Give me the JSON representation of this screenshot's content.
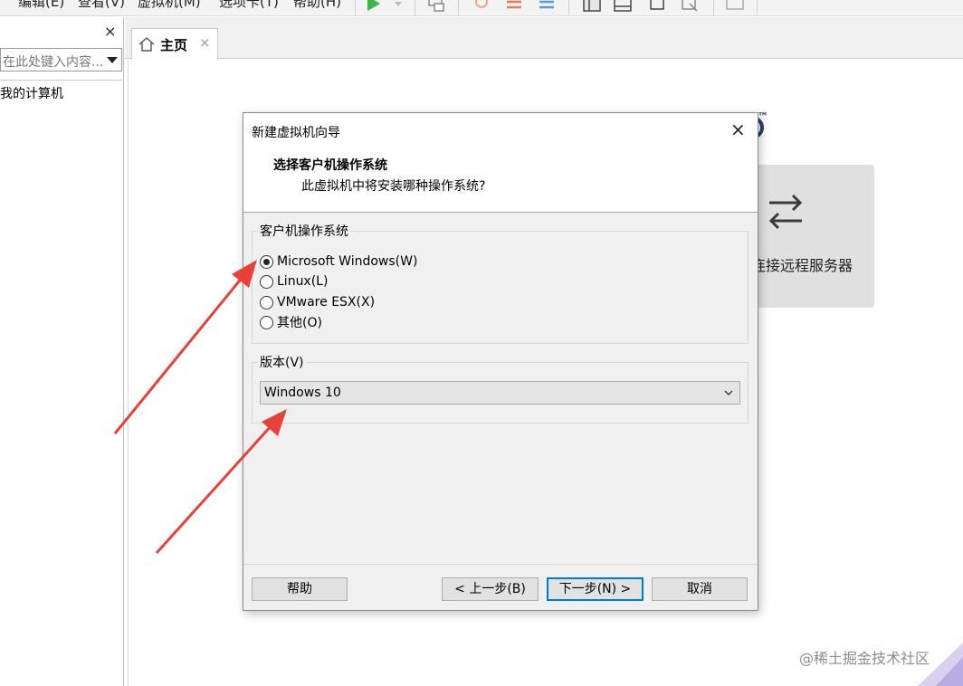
{
  "menu": {
    "items": [
      "编辑(E)",
      "查看(V)",
      "虚拟机(M)",
      "选项卡(T)",
      "帮助(H)"
    ]
  },
  "library": {
    "close_glyph": "×",
    "search_placeholder": "在此处键入内容...",
    "tree_items": [
      "我的计算机"
    ]
  },
  "tabs": [
    {
      "label": "主页",
      "close_glyph": "×"
    }
  ],
  "home": {
    "tm": "™",
    "remote_card_label": "连接远程服务器"
  },
  "dialog": {
    "title": "新建虚拟机向导",
    "close_glyph": "×",
    "heading": "选择客户机操作系统",
    "subheading": "此虚拟机中将安装哪种操作系统?",
    "os_group_label": "客户机操作系统",
    "os_options": [
      {
        "label": "Microsoft Windows(W)",
        "checked": true
      },
      {
        "label": "Linux(L)",
        "checked": false
      },
      {
        "label": "VMware ESX(X)",
        "checked": false
      },
      {
        "label": "其他(O)",
        "checked": false
      }
    ],
    "version_group_label": "版本(V)",
    "version_selected": "Windows 10",
    "buttons": {
      "help": "帮助",
      "back": "< 上一步(B)",
      "next": "下一步(N) >",
      "cancel": "取消"
    }
  },
  "watermark": "@稀土掘金技术社区",
  "colors": {
    "annotation_arrow": "#e8403a",
    "focus_border": "#0078d7",
    "logo_navy": "#2b3f69"
  }
}
